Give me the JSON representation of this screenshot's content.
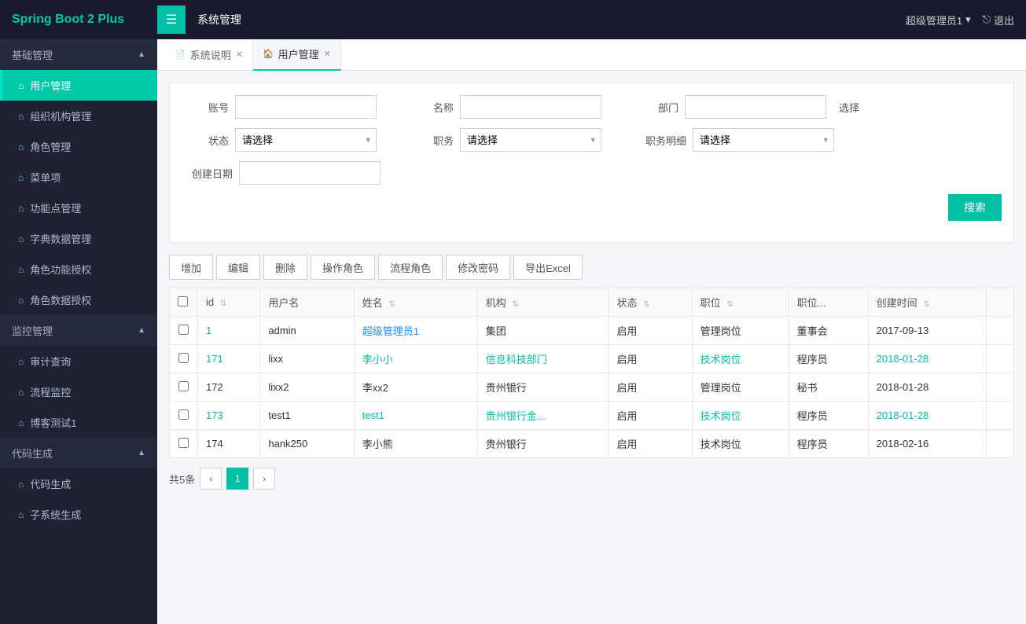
{
  "app": {
    "brand": "Spring Boot 2 Plus",
    "nav_title": "系统管理",
    "user": "超级管理员1",
    "logout_label": "退出"
  },
  "sidebar": {
    "sections": [
      {
        "name": "基础管理",
        "expanded": true,
        "items": [
          {
            "label": "用户管理",
            "active": true
          },
          {
            "label": "组织机构管理",
            "active": false
          },
          {
            "label": "角色管理",
            "active": false
          },
          {
            "label": "菜单项",
            "active": false
          },
          {
            "label": "功能点管理",
            "active": false
          },
          {
            "label": "字典数据管理",
            "active": false
          },
          {
            "label": "角色功能授权",
            "active": false
          },
          {
            "label": "角色数据授权",
            "active": false
          }
        ]
      },
      {
        "name": "监控管理",
        "expanded": true,
        "items": [
          {
            "label": "审计查询",
            "active": false
          },
          {
            "label": "流程监控",
            "active": false
          },
          {
            "label": "博客测试1",
            "active": false
          }
        ]
      },
      {
        "name": "代码生成",
        "expanded": true,
        "items": [
          {
            "label": "代码生成",
            "active": false
          },
          {
            "label": "子系统生成",
            "active": false
          }
        ]
      }
    ]
  },
  "tabs": [
    {
      "label": "系统说明",
      "icon": "📄",
      "closable": true,
      "active": false
    },
    {
      "label": "用户管理",
      "icon": "🏠",
      "closable": true,
      "active": true
    }
  ],
  "search_form": {
    "account_label": "账号",
    "account_placeholder": "",
    "name_label": "名称",
    "name_placeholder": "",
    "dept_label": "部门",
    "dept_placeholder": "",
    "select_label": "选择",
    "status_label": "状态",
    "status_placeholder": "请选择",
    "position_label": "职务",
    "position_placeholder": "请选择",
    "position_detail_label": "职务明细",
    "position_detail_placeholder": "请选择",
    "create_date_label": "创建日期",
    "search_btn": "搜索"
  },
  "toolbar": {
    "buttons": [
      "增加",
      "编辑",
      "删除",
      "操作角色",
      "流程角色",
      "修改密码",
      "导出Excel"
    ]
  },
  "table": {
    "columns": [
      "id",
      "用户名",
      "姓名",
      "机构",
      "状态",
      "职位",
      "职位...",
      "创建时间"
    ],
    "rows": [
      {
        "id": "1",
        "username": "admin",
        "name": "超级管理员1",
        "org": "集团",
        "status": "启用",
        "position": "管理岗位",
        "position_detail": "董事会",
        "created": "2017-09-13",
        "id_link": true,
        "name_link": true,
        "org_link": false,
        "pos_link": false,
        "created_link": false
      },
      {
        "id": "171",
        "username": "lixx",
        "name": "李小小",
        "org": "信息科技部门",
        "status": "启用",
        "position": "技术岗位",
        "position_detail": "程序员",
        "created": "2018-01-28",
        "id_link": true,
        "name_link": true,
        "org_link": true,
        "pos_link": true,
        "created_link": true
      },
      {
        "id": "172",
        "username": "lixx2",
        "name": "李xx2",
        "org": "贵州银行",
        "status": "启用",
        "position": "管理岗位",
        "position_detail": "秘书",
        "created": "2018-01-28",
        "id_link": false,
        "name_link": false,
        "org_link": false,
        "pos_link": false,
        "created_link": false
      },
      {
        "id": "173",
        "username": "test1",
        "name": "test1",
        "org": "贵州银行金...",
        "status": "启用",
        "position": "技术岗位",
        "position_detail": "程序员",
        "created": "2018-01-28",
        "id_link": true,
        "name_link": true,
        "org_link": true,
        "pos_link": true,
        "created_link": true
      },
      {
        "id": "174",
        "username": "hank250",
        "name": "李小熊",
        "org": "贵州银行",
        "status": "启用",
        "position": "技术岗位",
        "position_detail": "程序员",
        "created": "2018-02-16",
        "id_link": false,
        "name_link": false,
        "org_link": false,
        "pos_link": false,
        "created_link": false
      }
    ]
  },
  "pagination": {
    "total_label": "共5条",
    "current_page": 1,
    "pages": [
      1
    ]
  }
}
